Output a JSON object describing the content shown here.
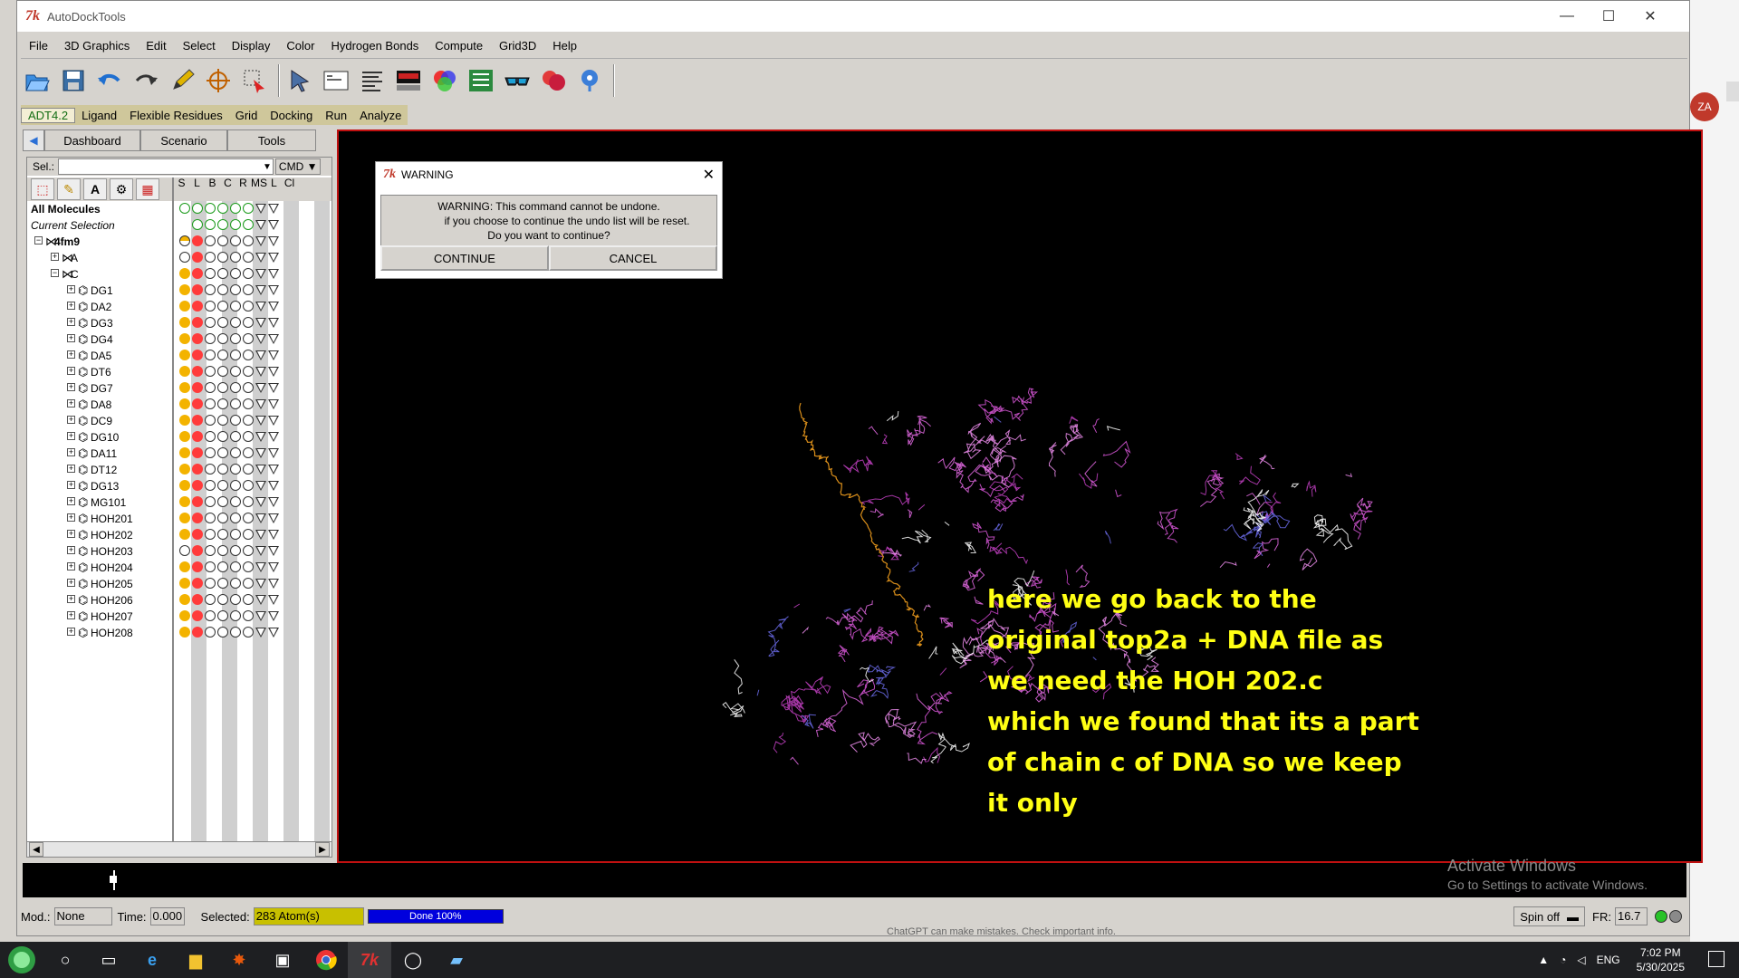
{
  "window": {
    "title": "AutoDockTools",
    "minimize": "—",
    "maximize": "☐",
    "close": "✕"
  },
  "menu": [
    "File",
    "3D Graphics",
    "Edit",
    "Select",
    "Display",
    "Color",
    "Hydrogen Bonds",
    "Compute",
    "Grid3D",
    "Help"
  ],
  "toolbar": [
    "open-file-icon",
    "save-icon",
    "undo-icon",
    "redo-icon",
    "pencil-icon",
    "center-target-icon",
    "select-region-icon",
    "pointer-icon",
    "python-shell-icon",
    "text-lines-icon",
    "color-bar-icon",
    "color-wheel-icon",
    "network-icon",
    "stereo-glasses-icon",
    "surface-icon",
    "info-icon"
  ],
  "adt_menu": [
    "ADT4.2",
    "Ligand",
    "Flexible Residues",
    "Grid",
    "Docking",
    "Run",
    "Analyze"
  ],
  "panel": {
    "tabs": [
      "Dashboard",
      "Scenario",
      "Tools"
    ],
    "sel_label": "Sel.:",
    "cmd_label": "CMD",
    "columns": [
      "S",
      "L",
      "B",
      "C",
      "R",
      "MS",
      "L",
      "Cl"
    ],
    "all_molecules": "All Molecules",
    "current_selection": "Current Selection",
    "tree": [
      {
        "label": "4fm9",
        "level": 0,
        "expander": "⊟"
      },
      {
        "label": "A",
        "level": 1,
        "expander": "⊞"
      },
      {
        "label": "C",
        "level": 1,
        "expander": "⊟"
      },
      {
        "label": "DG1",
        "level": 2,
        "expander": "⊞"
      },
      {
        "label": "DA2",
        "level": 2,
        "expander": "⊞"
      },
      {
        "label": "DG3",
        "level": 2,
        "expander": "⊞"
      },
      {
        "label": "DG4",
        "level": 2,
        "expander": "⊞"
      },
      {
        "label": "DA5",
        "level": 2,
        "expander": "⊞"
      },
      {
        "label": "DT6",
        "level": 2,
        "expander": "⊞"
      },
      {
        "label": "DG7",
        "level": 2,
        "expander": "⊞"
      },
      {
        "label": "DA8",
        "level": 2,
        "expander": "⊞"
      },
      {
        "label": "DC9",
        "level": 2,
        "expander": "⊞"
      },
      {
        "label": "DG10",
        "level": 2,
        "expander": "⊞"
      },
      {
        "label": "DA11",
        "level": 2,
        "expander": "⊞"
      },
      {
        "label": "DT12",
        "level": 2,
        "expander": "⊞"
      },
      {
        "label": "DG13",
        "level": 2,
        "expander": "⊞"
      },
      {
        "label": "MG101",
        "level": 2,
        "expander": "⊞"
      },
      {
        "label": "HOH201",
        "level": 2,
        "expander": "⊞"
      },
      {
        "label": "HOH202",
        "level": 2,
        "expander": "⊞"
      },
      {
        "label": "HOH203",
        "level": 2,
        "expander": "⊞"
      },
      {
        "label": "HOH204",
        "level": 2,
        "expander": "⊞"
      },
      {
        "label": "HOH205",
        "level": 2,
        "expander": "⊞"
      },
      {
        "label": "HOH206",
        "level": 2,
        "expander": "⊞"
      },
      {
        "label": "HOH207",
        "level": 2,
        "expander": "⊞"
      },
      {
        "label": "HOH208",
        "level": 2,
        "expander": "⊞"
      }
    ]
  },
  "dialog": {
    "title": "WARNING",
    "line1": "WARNING: This command cannot be undone.",
    "line2": "if you choose to continue the undo list will be reset.",
    "line3": "Do you want to continue?",
    "continue": "CONTINUE",
    "cancel": "CANCEL"
  },
  "viewer": {
    "caption": [
      "here we go back to the",
      "original top2a + DNA file as",
      "we need the HOH 202.c",
      "which we found that its a part",
      "of chain c of DNA  so we keep",
      "it only"
    ],
    "watermark_title": "Activate Windows",
    "watermark_sub": "Go to Settings to activate Windows."
  },
  "status": {
    "mod_label": "Mod.:",
    "mod_value": "None",
    "time_label": "Time:",
    "time_value": "0.000",
    "selected_label": "Selected:",
    "selected_value": "283 Atom(s)",
    "progress_label": "Done 100%",
    "progress_value": 1.0,
    "spin": "Spin off",
    "fr_label": "FR:",
    "fr_value": "16.7",
    "behind_text": "ChatGPT can make mistakes. Check important info."
  },
  "taskbar": {
    "lang": "ENG",
    "time": "7:02 PM",
    "date": "5/30/2025"
  },
  "avatar": "ZA",
  "colors": {
    "caption": "#ffff14",
    "viewer_border": "#c01010",
    "selected_bg": "#c8c000",
    "progress": "#0000dd"
  }
}
